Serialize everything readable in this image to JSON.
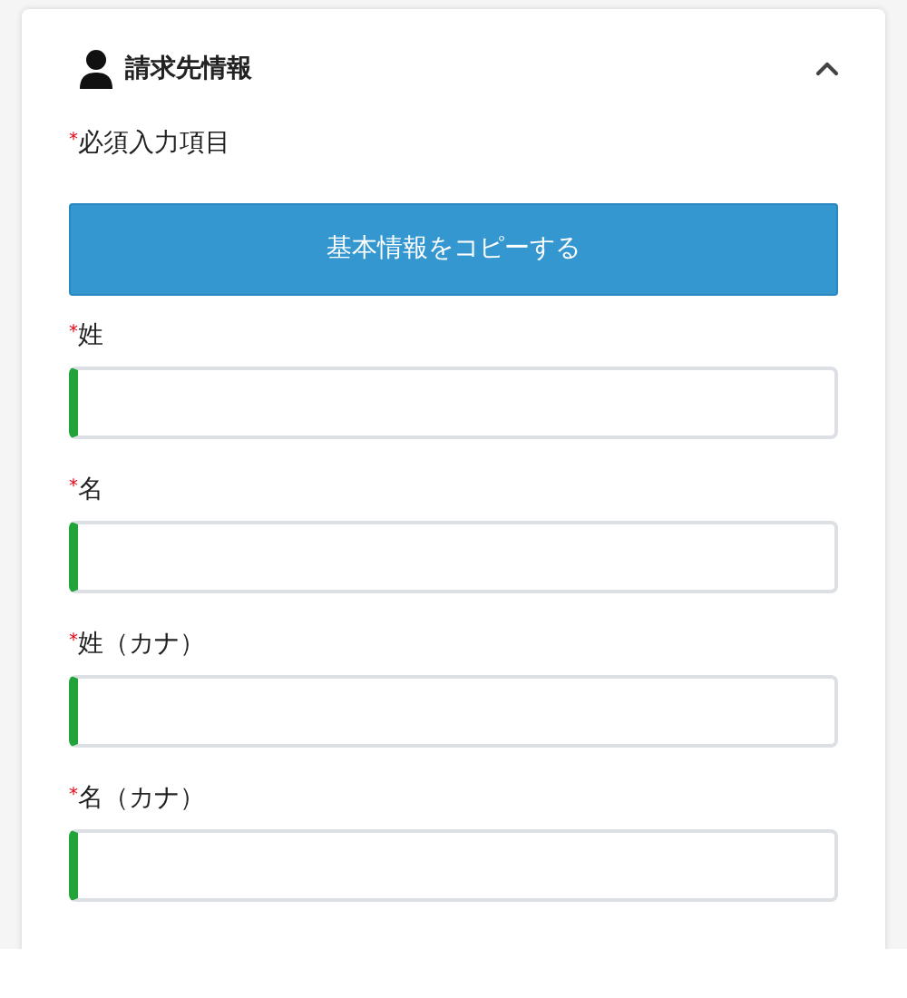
{
  "section": {
    "title": "請求先情報",
    "expanded": true
  },
  "required_note": {
    "mark": "*",
    "text": "必須入力項目"
  },
  "copy_button": "基本情報をコピーする",
  "fields": [
    {
      "label": "姓",
      "required": true
    },
    {
      "label": "名",
      "required": true
    },
    {
      "label": "姓（カナ）",
      "required": true
    },
    {
      "label": "名（カナ）",
      "required": true
    }
  ]
}
